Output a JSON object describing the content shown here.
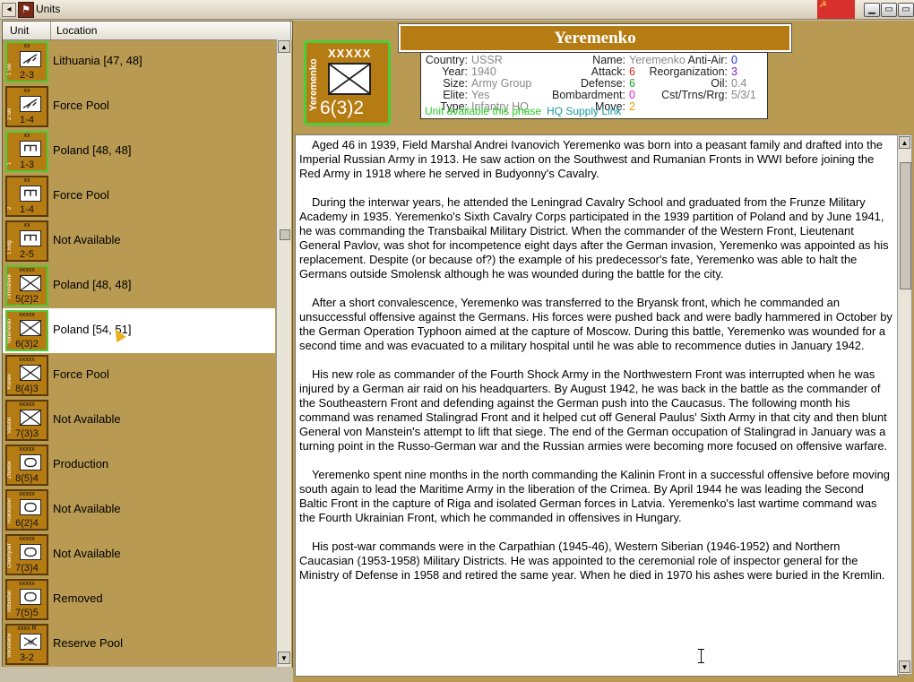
{
  "window": {
    "title": "Units",
    "flag_icon": "soviet-flag-icon"
  },
  "columns": {
    "unit": "Unit",
    "location": "Location"
  },
  "units": [
    {
      "size": "xx",
      "name": "1 Ski",
      "strength": "2-3",
      "location": "Lithuania [47, 48]",
      "green": true,
      "symbol": "ski"
    },
    {
      "size": "xx",
      "name": "2 Ski",
      "strength": "1-4",
      "location": "Force Pool",
      "green": false,
      "symbol": "ski"
    },
    {
      "size": "xx",
      "name": "1",
      "strength": "1-3",
      "location": "Poland [48, 48]",
      "green": true,
      "symbol": "engineer"
    },
    {
      "size": "xx",
      "name": "2",
      "strength": "1-4",
      "location": "Force Pool",
      "green": false,
      "symbol": "engineer"
    },
    {
      "size": "xx",
      "name": "1 Eng",
      "strength": "2-5",
      "location": "Not Available",
      "green": false,
      "symbol": "engineer"
    },
    {
      "size": "xxxxx",
      "name": "Timoshenko",
      "strength": "5(2)2",
      "location": "Poland [48, 48]",
      "green": true,
      "symbol": "infantry"
    },
    {
      "size": "xxxxx",
      "name": "Yeremenko",
      "strength": "6(3)2",
      "location": "Poland [54, 51]",
      "green": true,
      "symbol": "infantry",
      "selected": true
    },
    {
      "size": "xxxxx",
      "name": "Konev",
      "strength": "8(4)3",
      "location": "Force Pool",
      "green": false,
      "symbol": "infantry"
    },
    {
      "size": "xxxxx",
      "name": "Vatutin",
      "strength": "7(3)3",
      "location": "Not Available",
      "green": false,
      "symbol": "infantry"
    },
    {
      "size": "xxxxx",
      "name": "Zhukov",
      "strength": "8(5)4",
      "location": "Production",
      "green": false,
      "symbol": "armor"
    },
    {
      "size": "xxxxx",
      "name": "Rokossovsky",
      "strength": "6(2)4",
      "location": "Not Available",
      "green": false,
      "symbol": "armor"
    },
    {
      "size": "xxxxx",
      "name": "Chernyakh",
      "strength": "7(3)4",
      "location": "Not Available",
      "green": false,
      "symbol": "armor"
    },
    {
      "size": "xxxxx",
      "name": "Tolbukhin",
      "strength": "7(5)5",
      "location": "Removed",
      "green": false,
      "symbol": "armor"
    },
    {
      "size": "xxxx R",
      "name": "Voroshilov",
      "strength": "3-2",
      "location": "Reserve Pool",
      "green": false,
      "symbol": "militia"
    }
  ],
  "selected": {
    "name": "Yeremenko",
    "size": "XXXXX",
    "strength": "6(3)2",
    "stats": {
      "country_label": "Country:",
      "country": "USSR",
      "year_label": "Year:",
      "year": "1940",
      "size_label": "Size:",
      "size": "Army Group",
      "elite_label": "Elite:",
      "elite": "Yes",
      "type_label": "Type:",
      "type": "Infantry HQ",
      "name_label": "Name:",
      "name": "Yeremenko",
      "attack_label": "Attack:",
      "attack": "6",
      "defense_label": "Defense:",
      "defense": "6",
      "bombardment_label": "Bombardment:",
      "bombardment": "0",
      "move_label": "Move:",
      "move": "2",
      "antiair_label": "Anti-Air:",
      "antiair": "0",
      "reorg_label": "Reorganization:",
      "reorg": "3",
      "oil_label": "Oil:",
      "oil": "0.4",
      "cost_label": "Cst/Trns/Rrg:",
      "cost": "5/3/1",
      "available": "Unit available this phase",
      "hq_link": "HQ Supply Link"
    },
    "colors": {
      "attack": "#e02020",
      "defense": "#20a020",
      "bombardment": "#e020e0",
      "move": "#e0a000",
      "antiair": "#2030e0",
      "reorg": "#8020c0"
    },
    "bio": [
      "Aged 46 in 1939, Field Marshal Andrei Ivanovich Yeremenko was born into a peasant family and drafted into the Imperial Russian Army in 1913.  He saw action on the Southwest and Rumanian Fronts in WWI before joining the Red Army in 1918 where he served in Budyonny's Cavalry.",
      "During the interwar years, he attended the Leningrad Cavalry School and graduated from the Frunze Military Academy in 1935.  Yeremenko's Sixth Cavalry Corps participated in the 1939 partition of Poland and by June 1941, he was commanding the Transbaikal Military District.  When the commander of the Western Front, Lieutenant General Pavlov, was shot for incompetence eight days after the German invasion, Yeremenko was appointed as his replacement.  Despite (or because of?) the example of his predecessor's fate, Yeremenko was able to halt the Germans outside Smolensk although he was wounded during the battle for the city.",
      "After a short convalescence, Yeremenko was transferred to the Bryansk front, which he commanded an unsuccessful offensive against the Germans. His forces were pushed back and were badly hammered in October by the German Operation Typhoon aimed at the capture of Moscow. During this battle, Yeremenko was wounded for a second time and was evacuated to a military hospital until he was able to recommence duties in January 1942.",
      "His new role as commander of the Fourth Shock Army in the Northwestern Front was interrupted when he was injured by a German air raid on his headquarters. By August 1942, he was back in the battle as the commander of the Southeastern Front and defending against the German push into the Caucasus. The following month his command was renamed Stalingrad Front and it helped cut off General Paulus' Sixth Army in that city and then blunt General von Manstein's attempt to lift that siege.  The end of the German occupation of Stalingrad in January was a turning point in the Russo-German war and the Russian armies were becoming more focused on offensive warfare.",
      "Yeremenko spent nine months in the north commanding the Kalinin Front in a successful offensive before moving south again to lead the Maritime Army in the liberation of the Crimea.  By April 1944 he was leading the Second Baltic Front in the capture of Riga and isolated German forces in Latvia.  Yeremenko's last wartime command was the Fourth Ukrainian Front, which he commanded in offensives in Hungary.",
      "His post-war commands were in the Carpathian (1945-46), Western Siberian (1946-1952) and Northern Caucasian (1953-1958) Military Districts. He was appointed to the ceremonial role of inspector general for the Ministry of Defense in 1958 and retired the same year.  When he died in 1970 his ashes were buried in the Kremlin."
    ]
  }
}
